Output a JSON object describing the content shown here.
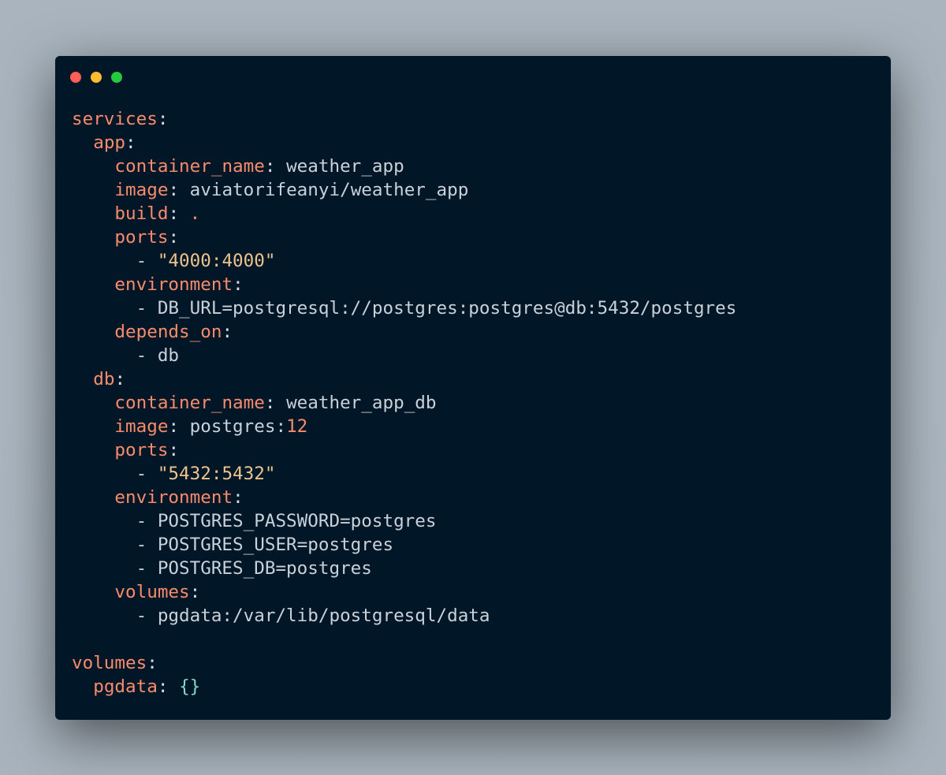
{
  "window": {
    "controls": [
      {
        "name": "close",
        "color": "#ff5f56"
      },
      {
        "name": "minimize",
        "color": "#ffbd2e"
      },
      {
        "name": "maximize",
        "color": "#27c93f"
      }
    ]
  },
  "code": {
    "language": "yaml",
    "lines": [
      [
        {
          "t": "key",
          "v": "services"
        },
        {
          "t": "punct",
          "v": ":"
        }
      ],
      [
        {
          "t": "plain",
          "v": "  "
        },
        {
          "t": "key",
          "v": "app"
        },
        {
          "t": "punct",
          "v": ":"
        }
      ],
      [
        {
          "t": "plain",
          "v": "    "
        },
        {
          "t": "key",
          "v": "container_name"
        },
        {
          "t": "punct",
          "v": ":"
        },
        {
          "t": "plain",
          "v": " weather_app"
        }
      ],
      [
        {
          "t": "plain",
          "v": "    "
        },
        {
          "t": "key",
          "v": "image"
        },
        {
          "t": "punct",
          "v": ":"
        },
        {
          "t": "plain",
          "v": " aviatorifeanyi/weather_app"
        }
      ],
      [
        {
          "t": "plain",
          "v": "    "
        },
        {
          "t": "key",
          "v": "build"
        },
        {
          "t": "punct",
          "v": ":"
        },
        {
          "t": "plain",
          "v": " "
        },
        {
          "t": "key",
          "v": "."
        }
      ],
      [
        {
          "t": "plain",
          "v": "    "
        },
        {
          "t": "key",
          "v": "ports"
        },
        {
          "t": "punct",
          "v": ":"
        }
      ],
      [
        {
          "t": "plain",
          "v": "      - "
        },
        {
          "t": "string",
          "v": "\"4000:4000\""
        }
      ],
      [
        {
          "t": "plain",
          "v": "    "
        },
        {
          "t": "key",
          "v": "environment"
        },
        {
          "t": "punct",
          "v": ":"
        }
      ],
      [
        {
          "t": "plain",
          "v": "      - DB_URL=postgresql://postgres:postgres@db:5432/postgres"
        }
      ],
      [
        {
          "t": "plain",
          "v": "    "
        },
        {
          "t": "key",
          "v": "depends_on"
        },
        {
          "t": "punct",
          "v": ":"
        }
      ],
      [
        {
          "t": "plain",
          "v": "      - db"
        }
      ],
      [
        {
          "t": "plain",
          "v": "  "
        },
        {
          "t": "key",
          "v": "db"
        },
        {
          "t": "punct",
          "v": ":"
        }
      ],
      [
        {
          "t": "plain",
          "v": "    "
        },
        {
          "t": "key",
          "v": "container_name"
        },
        {
          "t": "punct",
          "v": ":"
        },
        {
          "t": "plain",
          "v": " weather_app_db"
        }
      ],
      [
        {
          "t": "plain",
          "v": "    "
        },
        {
          "t": "key",
          "v": "image"
        },
        {
          "t": "punct",
          "v": ":"
        },
        {
          "t": "plain",
          "v": " postgres:"
        },
        {
          "t": "number",
          "v": "12"
        }
      ],
      [
        {
          "t": "plain",
          "v": "    "
        },
        {
          "t": "key",
          "v": "ports"
        },
        {
          "t": "punct",
          "v": ":"
        }
      ],
      [
        {
          "t": "plain",
          "v": "      - "
        },
        {
          "t": "string",
          "v": "\"5432:5432\""
        }
      ],
      [
        {
          "t": "plain",
          "v": "    "
        },
        {
          "t": "key",
          "v": "environment"
        },
        {
          "t": "punct",
          "v": ":"
        }
      ],
      [
        {
          "t": "plain",
          "v": "      - POSTGRES_PASSWORD=postgres"
        }
      ],
      [
        {
          "t": "plain",
          "v": "      - POSTGRES_USER=postgres"
        }
      ],
      [
        {
          "t": "plain",
          "v": "      - POSTGRES_DB=postgres"
        }
      ],
      [
        {
          "t": "plain",
          "v": "    "
        },
        {
          "t": "key",
          "v": "volumes"
        },
        {
          "t": "punct",
          "v": ":"
        }
      ],
      [
        {
          "t": "plain",
          "v": "      - pgdata:/var/lib/postgresql/data"
        }
      ],
      [],
      [
        {
          "t": "key",
          "v": "volumes"
        },
        {
          "t": "punct",
          "v": ":"
        }
      ],
      [
        {
          "t": "plain",
          "v": "  "
        },
        {
          "t": "key",
          "v": "pgdata"
        },
        {
          "t": "punct",
          "v": ":"
        },
        {
          "t": "plain",
          "v": " "
        },
        {
          "t": "brace",
          "v": "{}"
        }
      ]
    ]
  }
}
